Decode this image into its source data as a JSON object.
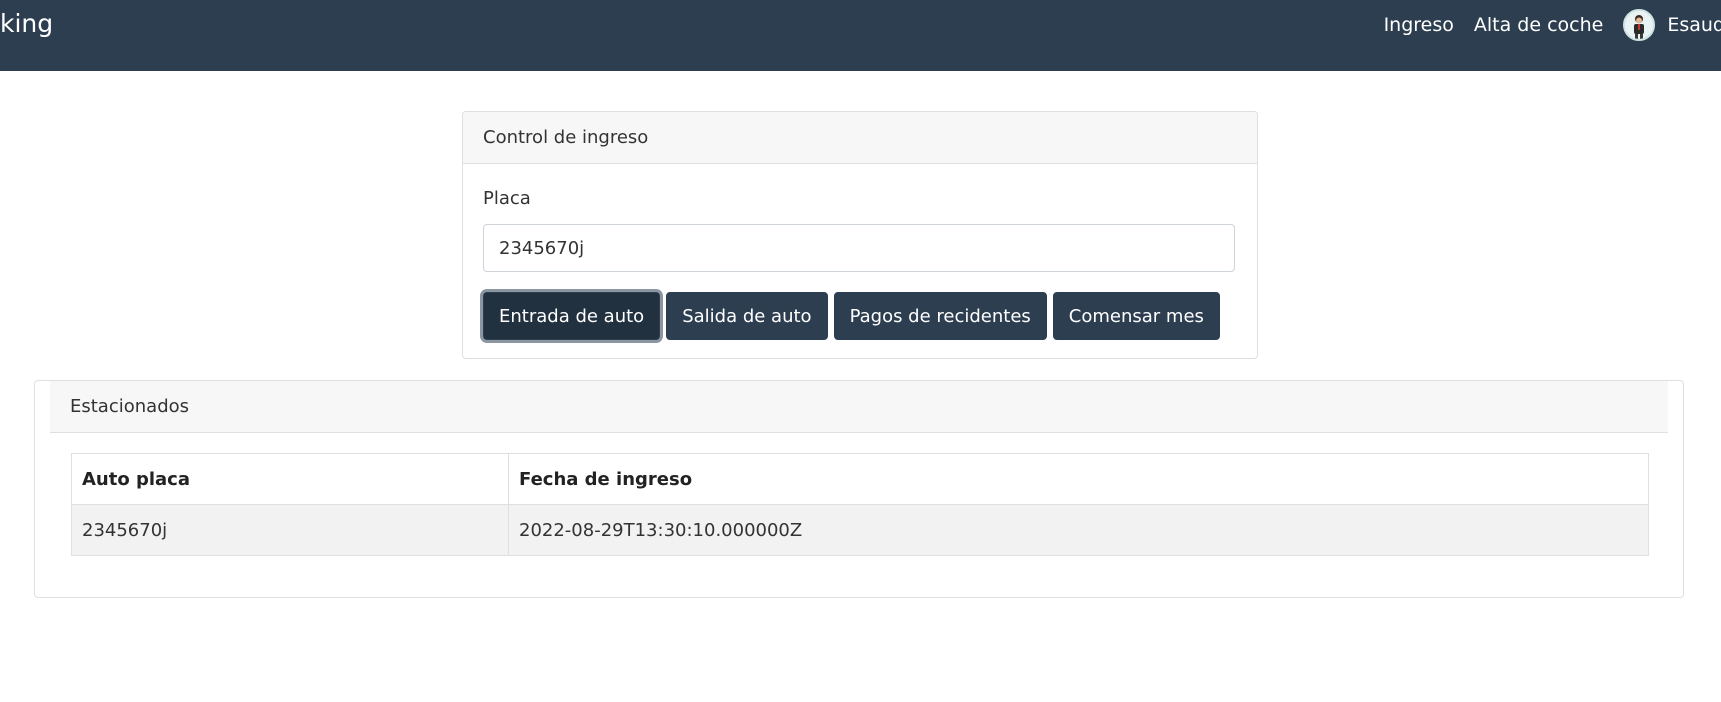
{
  "navbar": {
    "brand": "king",
    "links": [
      "Ingreso",
      "Alta de coche"
    ],
    "user_name": "Esaud",
    "avatar_icon": "user-avatar-icon",
    "bg_color": "#2c3e50"
  },
  "control": {
    "title": "Control de ingreso",
    "placa_label": "Placa",
    "placa_value": "2345670j",
    "buttons": [
      "Entrada de auto",
      "Salida de auto",
      "Pagos de recidentes",
      "Comensar mes"
    ]
  },
  "parked": {
    "title": "Estacionados",
    "columns": [
      "Auto placa",
      "Fecha de ingreso"
    ],
    "rows": [
      [
        "2345670j",
        "2022-08-29T13:30:10.000000Z"
      ]
    ]
  }
}
